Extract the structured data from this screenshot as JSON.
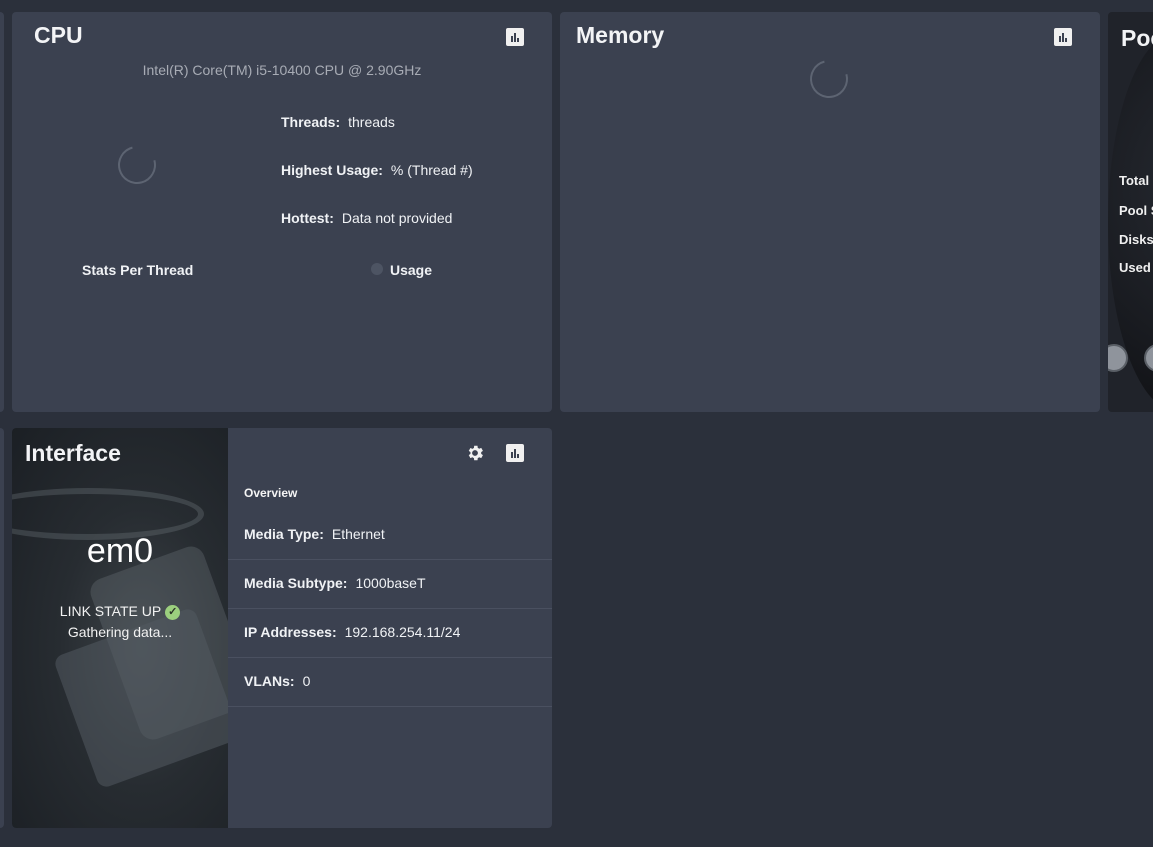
{
  "cpu": {
    "title": "CPU",
    "model": "Intel(R) Core(TM) i5-10400 CPU @ 2.90GHz",
    "threads_label": "Threads:",
    "threads_value": "threads",
    "highest_label": "Highest Usage:",
    "highest_value": "%  (Thread #)",
    "hottest_label": "Hottest:",
    "hottest_value": "Data not provided",
    "stats_per_thread": "Stats Per Thread",
    "legend_usage": "Usage",
    "chart_icon": "bar-chart-icon"
  },
  "memory": {
    "title": "Memory",
    "chart_icon": "bar-chart-icon"
  },
  "pool": {
    "title": "Poo",
    "lines": [
      "Total",
      "Pool S",
      "Disks",
      "Used"
    ]
  },
  "interface": {
    "title": "Interface",
    "name": "em0",
    "link_state": "LINK STATE UP",
    "status_text": "Gathering data...",
    "overview": "Overview",
    "rows": [
      {
        "label": "Media Type:",
        "value": "Ethernet"
      },
      {
        "label": "Media Subtype:",
        "value": "1000baseT"
      },
      {
        "label": "IP Addresses:",
        "value": "192.168.254.11/24"
      },
      {
        "label": "VLANs:",
        "value": "0"
      }
    ],
    "icons": [
      "gear-icon",
      "bar-chart-icon",
      "check-circle-icon"
    ]
  }
}
